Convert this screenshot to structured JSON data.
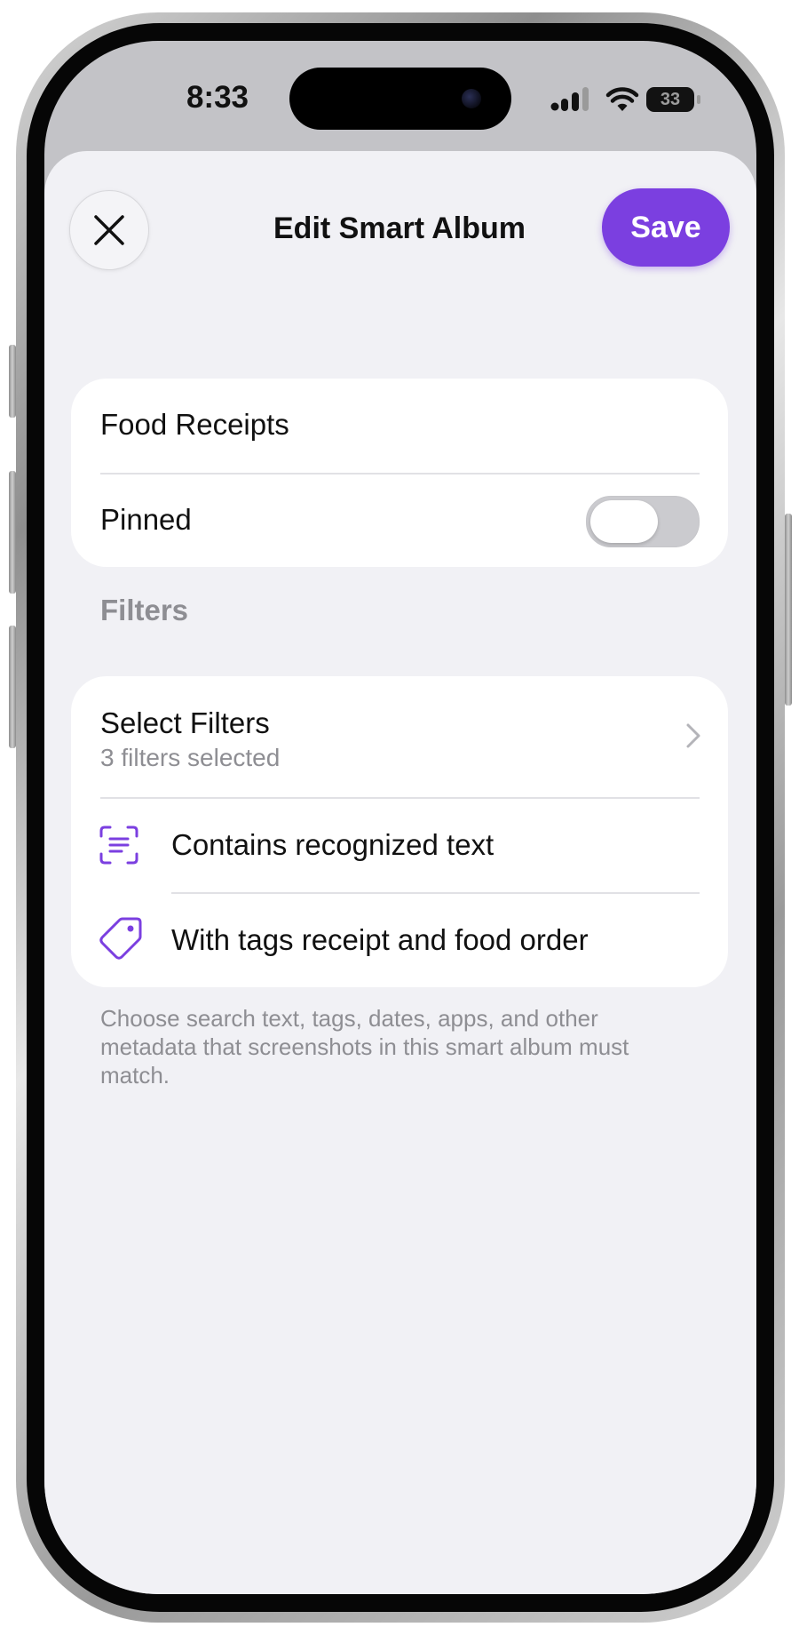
{
  "status_bar": {
    "time": "8:33",
    "battery": "33"
  },
  "header": {
    "title": "Edit Smart Album",
    "save_label": "Save",
    "close_icon": "close-icon",
    "accent_color": "#7b3fe0"
  },
  "album": {
    "name": "Food Receipts",
    "pinned_label": "Pinned",
    "pinned": false
  },
  "filters": {
    "section_title": "Filters",
    "select_title": "Select Filters",
    "select_subtitle": "3 filters selected",
    "items": [
      {
        "icon": "text-scan-icon",
        "label": "Contains recognized text"
      },
      {
        "icon": "tag-icon",
        "label": "With tags receipt and food order"
      }
    ],
    "footnote": "Choose search text, tags, dates, apps, and other metadata that screenshots in this smart album must match."
  }
}
